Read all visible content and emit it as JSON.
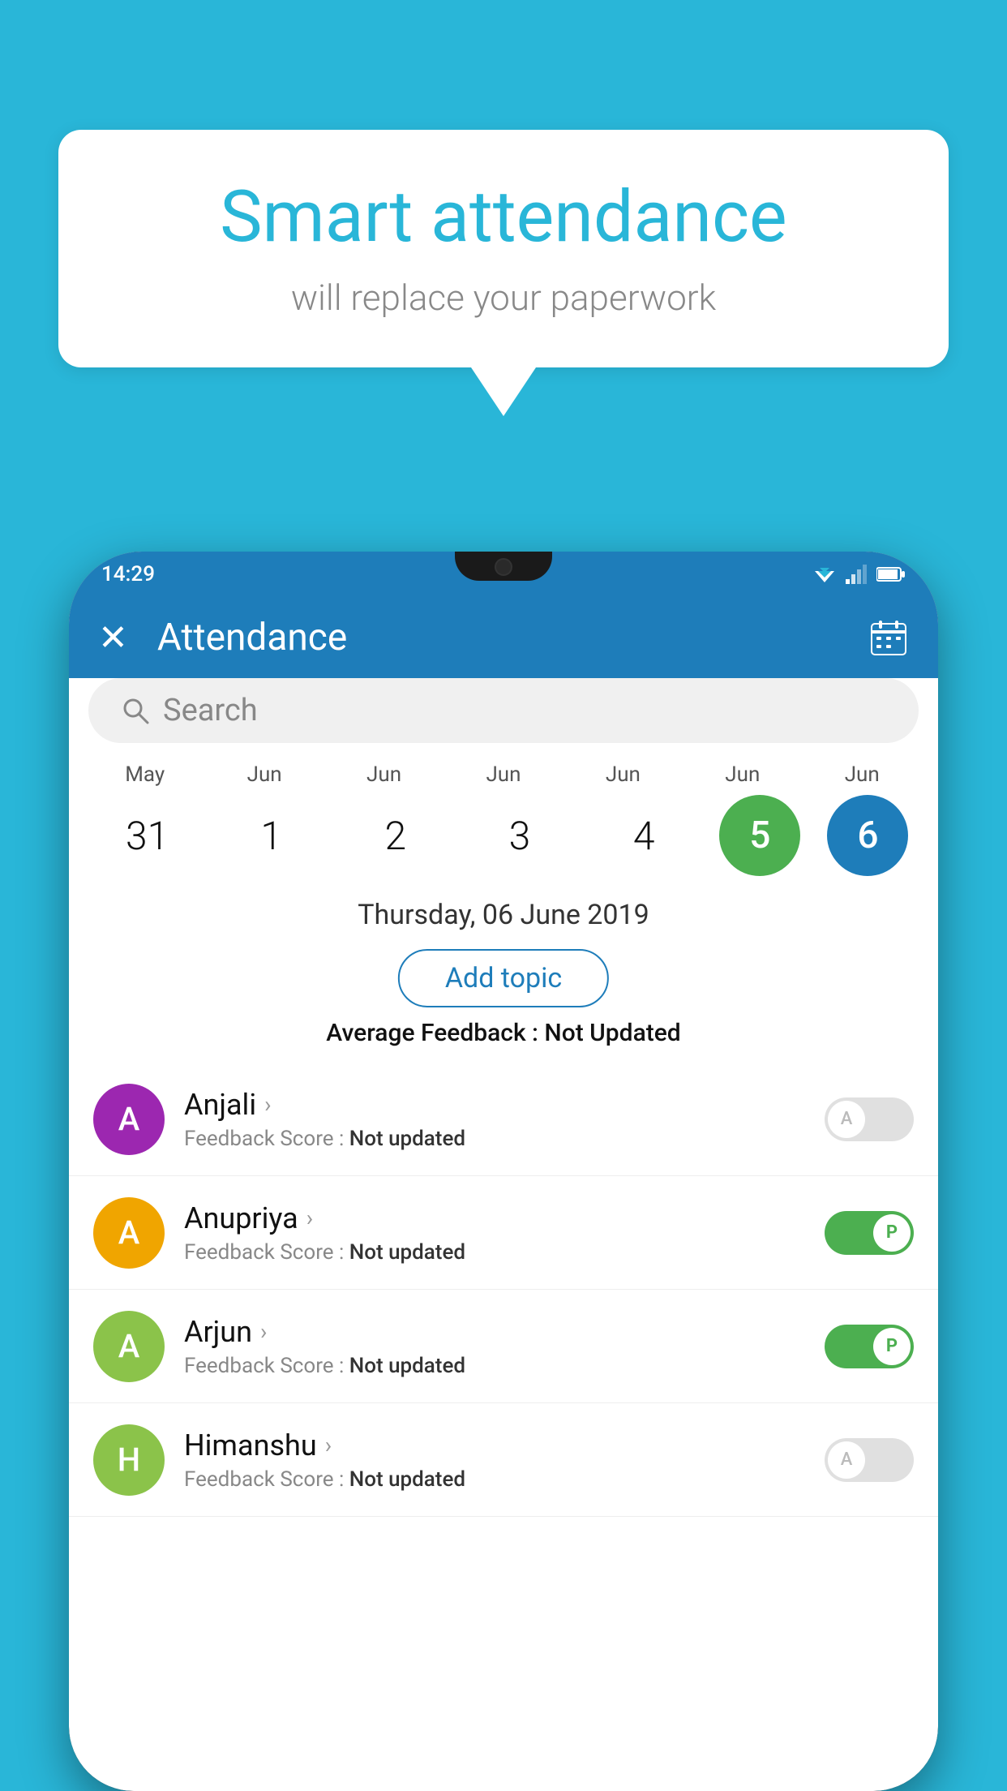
{
  "background_color": "#29b6d8",
  "speech_bubble": {
    "title": "Smart attendance",
    "subtitle": "will replace your paperwork"
  },
  "status_bar": {
    "time": "14:29",
    "wifi": "▼",
    "signal": "▲",
    "battery": "█"
  },
  "app_bar": {
    "close_label": "✕",
    "title": "Attendance",
    "calendar_icon": "📅"
  },
  "search": {
    "placeholder": "Search"
  },
  "calendar": {
    "months": [
      "May",
      "Jun",
      "Jun",
      "Jun",
      "Jun",
      "Jun",
      "Jun"
    ],
    "dates": [
      "31",
      "1",
      "2",
      "3",
      "4",
      "5",
      "6"
    ],
    "active_green_index": 5,
    "active_blue_index": 6
  },
  "selected_date_label": "Thursday, 06 June 2019",
  "add_topic_label": "Add topic",
  "average_feedback": {
    "label": "Average Feedback : ",
    "value": "Not Updated"
  },
  "students": [
    {
      "name": "Anjali",
      "avatar_letter": "A",
      "avatar_color": "#9c27b0",
      "feedback_label": "Feedback Score : ",
      "feedback_value": "Not updated",
      "toggle_state": "off",
      "toggle_label": "A"
    },
    {
      "name": "Anupriya",
      "avatar_letter": "A",
      "avatar_color": "#f0a500",
      "feedback_label": "Feedback Score : ",
      "feedback_value": "Not updated",
      "toggle_state": "on",
      "toggle_label": "P"
    },
    {
      "name": "Arjun",
      "avatar_letter": "A",
      "avatar_color": "#8bc34a",
      "feedback_label": "Feedback Score : ",
      "feedback_value": "Not updated",
      "toggle_state": "on",
      "toggle_label": "P"
    },
    {
      "name": "Himanshu",
      "avatar_letter": "H",
      "avatar_color": "#8bc34a",
      "feedback_label": "Feedback Score : ",
      "feedback_value": "Not updated",
      "toggle_state": "off",
      "toggle_label": "A"
    }
  ]
}
